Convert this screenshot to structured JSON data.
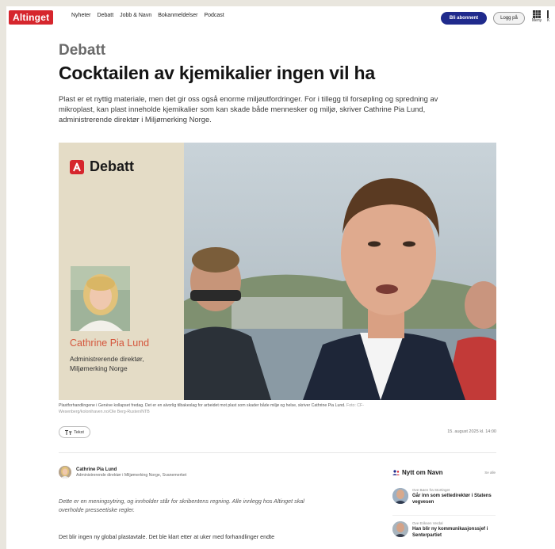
{
  "nav": {
    "logo": "Altinget",
    "links": [
      "Nyheter",
      "Debatt",
      "Jobb & Navn",
      "Bokanmeldelser",
      "Podcast"
    ],
    "subscribe": "Bli abonnent",
    "login": "Logg på",
    "menu_label": "Meny",
    "cut_label": "K"
  },
  "article": {
    "section": "Debatt",
    "headline": "Cocktailen av kjemikalier ingen vil ha",
    "lead": "Plast er et nyttig materiale, men det gir oss også enorme miljøutfordringer. For i tillegg til forsøpling og spredning av mikroplast, kan plast inneholde kjemikalier som kan skade både mennesker og miljø, skriver Cathrine Pia Lund, administrerende direktør i Miljømerking Norge."
  },
  "hero": {
    "badge": "Debatt",
    "person_name": "Cathrine Pia Lund",
    "person_role_1": "Administrerende direktør,",
    "person_role_2": "Miljømerking Norge"
  },
  "caption": {
    "text": "Plastforhandlingene i Genève kollapset fredag. Det er en alvorlig tilbakeslag for arbeidet mot plast som skader både miljø og helse, skriver Cathrine Pia Lund.",
    "credit_1": "Foto: CF-",
    "credit_2": "Wesenberg/kolonihaven.no/Ole Berg-Rusten/NTB"
  },
  "tools": {
    "tts": "Tekst",
    "date": "15. august 2025 kl. 14:00"
  },
  "author": {
    "name": "Cathrine Pia Lund",
    "role": "Administrerende direktør i Miljømerking Norge, Svanemerket"
  },
  "body": {
    "disclaimer": "Dette er en meningsytring, og innholder står for skribentens regning. Alle innlegg hos Altinget skal overholde presseetiske regler.",
    "p1": "Det blir ingen ny global plastavtale. Det ble klart etter at uker med forhandlinger endte"
  },
  "sidebar": {
    "title": "Nytt om Navn",
    "more": "Se alle",
    "items": [
      {
        "meta": "Ove Bøen fra Stortinget",
        "title": "Går inn som settedirektør i Statens vegvesen"
      },
      {
        "meta": "Ove Eriksen Verdal",
        "title": "Han blir ny kommunikasjonssjef i Senterpartiet"
      }
    ]
  },
  "colors": {
    "brand_red": "#d6262d",
    "subscribe_blue": "#1f2a8c",
    "hero_beige": "#e4dcc6",
    "name_orange": "#d4563c"
  }
}
